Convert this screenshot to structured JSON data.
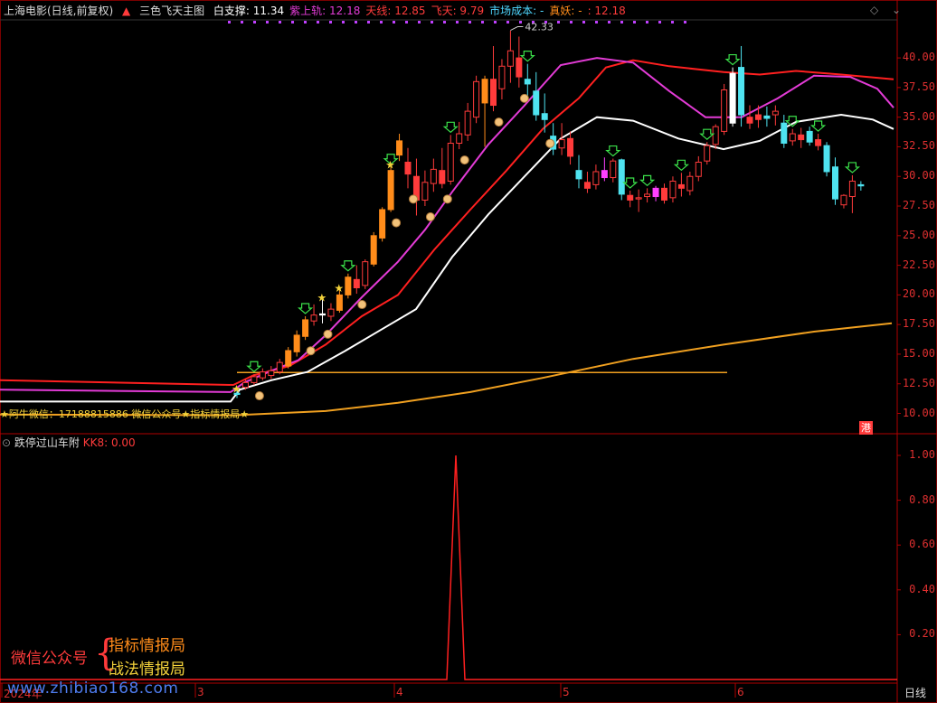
{
  "header": {
    "stock_name": "上海电影(日线,前复权)",
    "indicator_name": "三色飞天主图",
    "items": [
      {
        "label": "白支撑: 11.34",
        "color": "#ffffff"
      },
      {
        "label": "紫上轨: 12.18",
        "color": "#e33bd6"
      },
      {
        "label": "天线: 12.85",
        "color": "#ff3b3b"
      },
      {
        "label": "飞天: 9.79",
        "color": "#ff3b3b"
      },
      {
        "label": "市场成本: -",
        "color": "#4fd7ff"
      },
      {
        "label": "真妖: -",
        "color": "#ff8c1a"
      },
      {
        "label": ": 12.18",
        "color": "#ff3b3b"
      }
    ]
  },
  "sub_header": {
    "indicator_name": "跌停过山车附",
    "value_label": "KK8: 0.00"
  },
  "annotation": {
    "high_label": "42.33",
    "bottom_text": "★阿牛微信：17188815886   微信公众号★指标情报局★",
    "badge": "港"
  },
  "timeframe": "日线",
  "wechat": {
    "label": "微信公众号",
    "line1": "指标情报局",
    "line2": "战法情报局"
  },
  "watermark": "www.zhibiao168.com",
  "main_axis_ticks": [
    "40.00",
    "37.50",
    "35.00",
    "32.50",
    "30.00",
    "27.50",
    "25.00",
    "22.50",
    "20.00",
    "17.50",
    "15.00",
    "12.50",
    "10.00"
  ],
  "sub_axis_ticks": [
    "1.00",
    "0.80",
    "0.60",
    "0.40",
    "0.20"
  ],
  "x_labels": [
    "2024年",
    "3",
    "4",
    "5",
    "6"
  ],
  "chart_data": [
    {
      "type": "candlestick",
      "title": "三色飞天主图",
      "ylim": [
        9,
        42
      ],
      "candles": [
        {
          "o": 11.6,
          "h": 11.9,
          "l": 11.3,
          "c": 11.7,
          "cl": "cyan"
        },
        {
          "o": 12.2,
          "h": 12.9,
          "l": 12.0,
          "c": 12.6,
          "cl": "red"
        },
        {
          "o": 12.6,
          "h": 13.3,
          "l": 12.4,
          "c": 13.1,
          "cl": "red"
        },
        {
          "o": 13.0,
          "h": 13.8,
          "l": 12.8,
          "c": 13.5,
          "cl": "red"
        },
        {
          "o": 13.2,
          "h": 14.0,
          "l": 12.9,
          "c": 13.6,
          "cl": "red"
        },
        {
          "o": 13.5,
          "h": 14.6,
          "l": 13.3,
          "c": 14.3,
          "cl": "red"
        },
        {
          "o": 14.0,
          "h": 15.6,
          "l": 13.8,
          "c": 15.3,
          "cl": "orange"
        },
        {
          "o": 15.2,
          "h": 17.0,
          "l": 14.8,
          "c": 16.6,
          "cl": "orange"
        },
        {
          "o": 16.5,
          "h": 18.2,
          "l": 16.2,
          "c": 17.9,
          "cl": "orange"
        },
        {
          "o": 17.8,
          "h": 19.2,
          "l": 17.4,
          "c": 18.3,
          "cl": "red"
        },
        {
          "o": 18.3,
          "h": 19.6,
          "l": 17.6,
          "c": 18.4,
          "cl": "white"
        },
        {
          "o": 18.2,
          "h": 19.3,
          "l": 17.8,
          "c": 18.8,
          "cl": "red"
        },
        {
          "o": 18.7,
          "h": 20.4,
          "l": 18.5,
          "c": 20.0,
          "cl": "orange"
        },
        {
          "o": 20.0,
          "h": 21.8,
          "l": 19.7,
          "c": 21.5,
          "cl": "orange"
        },
        {
          "o": 21.3,
          "h": 22.5,
          "l": 20.1,
          "c": 20.6,
          "cl": "red"
        },
        {
          "o": 20.8,
          "h": 23.0,
          "l": 20.5,
          "c": 22.8,
          "cl": "red"
        },
        {
          "o": 22.6,
          "h": 25.3,
          "l": 22.4,
          "c": 25.0,
          "cl": "orange"
        },
        {
          "o": 24.8,
          "h": 27.4,
          "l": 24.5,
          "c": 27.2,
          "cl": "orange"
        },
        {
          "o": 27.2,
          "h": 30.8,
          "l": 27.0,
          "c": 30.5,
          "cl": "orange"
        },
        {
          "o": 31.8,
          "h": 33.6,
          "l": 31.3,
          "c": 33.0,
          "cl": "orange"
        },
        {
          "o": 31.2,
          "h": 32.4,
          "l": 29.0,
          "c": 30.2,
          "cl": "red"
        },
        {
          "o": 30.0,
          "h": 31.5,
          "l": 26.7,
          "c": 28.0,
          "cl": "red"
        },
        {
          "o": 28.0,
          "h": 30.5,
          "l": 27.5,
          "c": 29.5,
          "cl": "red"
        },
        {
          "o": 29.4,
          "h": 31.5,
          "l": 28.7,
          "c": 30.6,
          "cl": "red"
        },
        {
          "o": 30.5,
          "h": 32.4,
          "l": 29.0,
          "c": 29.4,
          "cl": "red"
        },
        {
          "o": 29.6,
          "h": 33.5,
          "l": 29.3,
          "c": 32.8,
          "cl": "red"
        },
        {
          "o": 32.8,
          "h": 34.6,
          "l": 32.3,
          "c": 33.6,
          "cl": "red"
        },
        {
          "o": 33.5,
          "h": 36.2,
          "l": 33.0,
          "c": 35.5,
          "cl": "red"
        },
        {
          "o": 35.0,
          "h": 38.5,
          "l": 34.5,
          "c": 38.0,
          "cl": "red"
        },
        {
          "o": 36.2,
          "h": 38.5,
          "l": 32.5,
          "c": 38.2,
          "cl": "orange"
        },
        {
          "o": 38.2,
          "h": 41.0,
          "l": 35.5,
          "c": 36.0,
          "cl": "red"
        },
        {
          "o": 37.4,
          "h": 39.9,
          "l": 36.5,
          "c": 39.3,
          "cl": "red"
        },
        {
          "o": 39.3,
          "h": 42.3,
          "l": 37.9,
          "c": 40.6,
          "cl": "red"
        },
        {
          "o": 40.0,
          "h": 41.8,
          "l": 37.5,
          "c": 38.4,
          "cl": "red"
        },
        {
          "o": 38.2,
          "h": 39.5,
          "l": 36.5,
          "c": 37.8,
          "cl": "cyan"
        },
        {
          "o": 37.2,
          "h": 38.8,
          "l": 34.7,
          "c": 35.2,
          "cl": "cyan"
        },
        {
          "o": 35.3,
          "h": 37.0,
          "l": 33.7,
          "c": 34.8,
          "cl": "cyan"
        },
        {
          "o": 33.4,
          "h": 34.5,
          "l": 31.8,
          "c": 32.3,
          "cl": "cyan"
        },
        {
          "o": 32.4,
          "h": 34.5,
          "l": 31.8,
          "c": 33.1,
          "cl": "red"
        },
        {
          "o": 33.2,
          "h": 33.8,
          "l": 31.0,
          "c": 31.7,
          "cl": "red"
        },
        {
          "o": 30.5,
          "h": 31.8,
          "l": 29.0,
          "c": 29.8,
          "cl": "cyan"
        },
        {
          "o": 29.5,
          "h": 30.4,
          "l": 28.6,
          "c": 29.0,
          "cl": "red"
        },
        {
          "o": 29.3,
          "h": 31.0,
          "l": 28.9,
          "c": 30.4,
          "cl": "red"
        },
        {
          "o": 30.5,
          "h": 31.6,
          "l": 29.6,
          "c": 29.9,
          "cl": "magenta"
        },
        {
          "o": 29.9,
          "h": 31.5,
          "l": 29.5,
          "c": 31.3,
          "cl": "red"
        },
        {
          "o": 31.4,
          "h": 31.5,
          "l": 28.0,
          "c": 28.5,
          "cl": "cyan"
        },
        {
          "o": 28.4,
          "h": 28.8,
          "l": 27.4,
          "c": 28.0,
          "cl": "red"
        },
        {
          "o": 28.1,
          "h": 28.9,
          "l": 27.0,
          "c": 28.2,
          "cl": "red"
        },
        {
          "o": 28.3,
          "h": 29.0,
          "l": 27.8,
          "c": 28.5,
          "cl": "red"
        },
        {
          "o": 28.3,
          "h": 29.2,
          "l": 27.9,
          "c": 29.0,
          "cl": "magenta"
        },
        {
          "o": 29.0,
          "h": 29.4,
          "l": 27.7,
          "c": 28.0,
          "cl": "red"
        },
        {
          "o": 28.2,
          "h": 30.0,
          "l": 27.8,
          "c": 29.6,
          "cl": "red"
        },
        {
          "o": 29.3,
          "h": 30.3,
          "l": 28.3,
          "c": 29.0,
          "cl": "red"
        },
        {
          "o": 28.8,
          "h": 30.4,
          "l": 28.4,
          "c": 30.0,
          "cl": "red"
        },
        {
          "o": 30.0,
          "h": 31.7,
          "l": 29.6,
          "c": 31.2,
          "cl": "red"
        },
        {
          "o": 31.3,
          "h": 32.9,
          "l": 31.0,
          "c": 32.6,
          "cl": "red"
        },
        {
          "o": 32.7,
          "h": 34.4,
          "l": 32.3,
          "c": 34.2,
          "cl": "red"
        },
        {
          "o": 33.8,
          "h": 37.8,
          "l": 33.5,
          "c": 37.3,
          "cl": "red"
        },
        {
          "o": 34.5,
          "h": 39.2,
          "l": 34.2,
          "c": 38.7,
          "cl": "white"
        },
        {
          "o": 39.2,
          "h": 41.0,
          "l": 34.2,
          "c": 35.2,
          "cl": "cyan"
        },
        {
          "o": 35.0,
          "h": 36.0,
          "l": 34.0,
          "c": 34.5,
          "cl": "red"
        },
        {
          "o": 35.2,
          "h": 36.0,
          "l": 34.1,
          "c": 34.8,
          "cl": "red"
        },
        {
          "o": 35.1,
          "h": 35.9,
          "l": 34.2,
          "c": 34.9,
          "cl": "cyan"
        },
        {
          "o": 35.2,
          "h": 36.0,
          "l": 34.3,
          "c": 35.5,
          "cl": "red"
        },
        {
          "o": 34.5,
          "h": 35.2,
          "l": 32.4,
          "c": 32.8,
          "cl": "cyan"
        },
        {
          "o": 33.0,
          "h": 34.0,
          "l": 32.6,
          "c": 33.6,
          "cl": "red"
        },
        {
          "o": 33.5,
          "h": 34.1,
          "l": 32.4,
          "c": 33.1,
          "cl": "red"
        },
        {
          "o": 33.8,
          "h": 34.2,
          "l": 32.6,
          "c": 32.9,
          "cl": "cyan"
        },
        {
          "o": 33.1,
          "h": 33.6,
          "l": 32.2,
          "c": 32.6,
          "cl": "red"
        },
        {
          "o": 32.6,
          "h": 32.9,
          "l": 30.0,
          "c": 30.4,
          "cl": "cyan"
        },
        {
          "o": 30.8,
          "h": 31.6,
          "l": 27.6,
          "c": 28.1,
          "cl": "cyan"
        },
        {
          "o": 27.6,
          "h": 28.5,
          "l": 27.3,
          "c": 28.4,
          "cl": "red"
        },
        {
          "o": 28.3,
          "h": 30.1,
          "l": 26.9,
          "c": 29.6,
          "cl": "red"
        },
        {
          "o": 29.3,
          "h": 29.6,
          "l": 28.8,
          "c": 29.2,
          "cl": "cyan"
        }
      ],
      "lines": [
        {
          "name": "白支撑",
          "color": "#ffffff"
        },
        {
          "name": "紫上轨",
          "color": "#e33bd6"
        },
        {
          "name": "天线",
          "color": "#ff2020"
        },
        {
          "name": "飞天",
          "color": "#f0a020"
        }
      ],
      "high_point": 42.33
    },
    {
      "type": "line",
      "title": "跌停过山车附",
      "ylim": [
        0,
        1.05
      ],
      "series": [
        {
          "name": "KK8",
          "spike_at_fraction": 0.51,
          "peak": 1.0
        }
      ]
    }
  ]
}
